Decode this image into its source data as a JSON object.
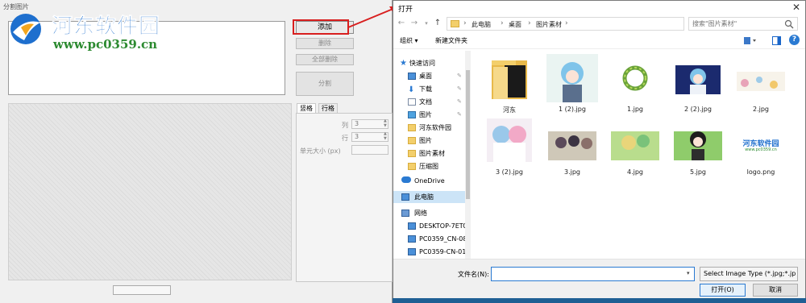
{
  "background_app": {
    "title": "分割图片",
    "add_button": "添加",
    "delete_button": "删除",
    "delete_all_button": "全部删除",
    "split_button": "分割",
    "tabs": [
      "竖格",
      "行格"
    ],
    "settings": {
      "cols_label": "列",
      "cols_value": "3",
      "rows_label": "行",
      "rows_value": "3",
      "cell_size_label": "单元大小 (px)"
    }
  },
  "watermark": {
    "title": "河东软件园",
    "url": "www.pc0359.cn"
  },
  "dialog": {
    "title": "打开",
    "close_glyph": "✕",
    "breadcrumbs": [
      "此电脑",
      "桌面",
      "图片素材"
    ],
    "search_placeholder": "搜索\"图片素材\"",
    "organize_label": "组织 ▾",
    "new_folder_label": "新建文件夹",
    "nav": {
      "quick_access": "快速访问",
      "pinned": [
        {
          "label": "桌面"
        },
        {
          "label": "下载"
        },
        {
          "label": "文档"
        },
        {
          "label": "图片"
        }
      ],
      "folders": [
        "河东软件园",
        "图片",
        "图片素材",
        "压缩图"
      ],
      "onedrive": "OneDrive",
      "this_pc": "此电脑",
      "network": "网络",
      "computers": [
        "DESKTOP-7ETC",
        "PC0359_CN-08",
        "PC0359-CN-01"
      ]
    },
    "files": [
      {
        "name": "河东",
        "kind": "folder"
      },
      {
        "name": "1 (2).jpg",
        "kind": "anime-blue"
      },
      {
        "name": "1.jpg",
        "kind": "wreath"
      },
      {
        "name": "2 (2).jpg",
        "kind": "anime-night"
      },
      {
        "name": "2.jpg",
        "kind": "sketch"
      },
      {
        "name": "3 (2).jpg",
        "kind": "anime-pink"
      },
      {
        "name": "3.jpg",
        "kind": "anime-group"
      },
      {
        "name": "4.jpg",
        "kind": "anime-green"
      },
      {
        "name": "5.jpg",
        "kind": "anime-dark"
      },
      {
        "name": "logo.png",
        "kind": "logo",
        "logo_text": "河东软件园",
        "logo_url": "www.pc0359.cn"
      }
    ],
    "filename_label": "文件名(N):",
    "filename_value": "",
    "file_type": "Select Image Type  (*.jpg;*.jp",
    "open_button": "打开(O)",
    "cancel_button": "取消",
    "colors": {
      "accent": "#2a7ad2",
      "selection": "#cce4f7",
      "folder": "#f3cf6b"
    }
  }
}
